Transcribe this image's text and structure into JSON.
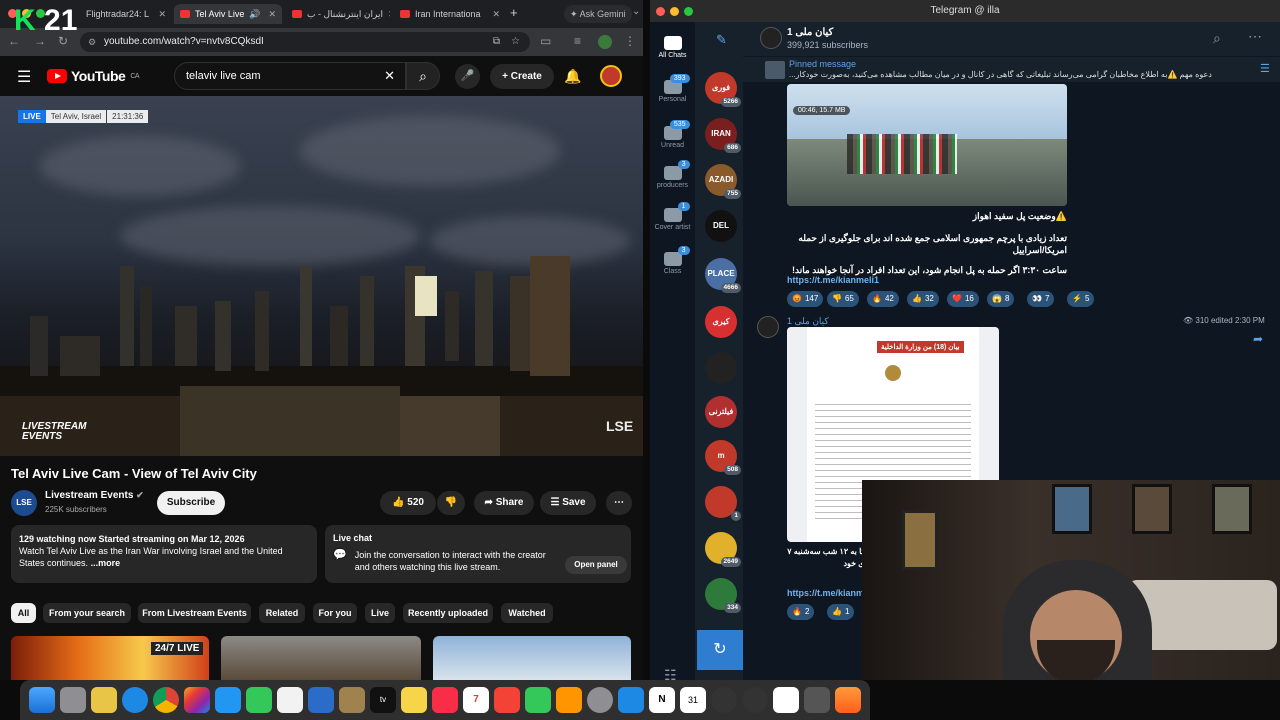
{
  "browser": {
    "tabs": [
      {
        "label": "Flightradar24: L"
      },
      {
        "label": "Tel Aviv Live"
      },
      {
        "label": "ایران اینترنشنال - ب"
      },
      {
        "label": "Iran Internationa"
      }
    ],
    "ask_gemini": "Ask Gemini",
    "url": "youtube.com/watch?v=nvtv8CQksdI",
    "k21_number": "21"
  },
  "youtube": {
    "logo": "YouTube",
    "region": "CA",
    "search_value": "telaviv live cam",
    "create_label": "Create",
    "video": {
      "live_label": "LIVE",
      "location": "Tel Aviv, Israel",
      "time": "21:31:36",
      "watermark": "LSE",
      "logo_line1": "LIVESTREAM",
      "logo_line2": "EVENTS"
    },
    "title": "Tel Aviv Live Cam - View of Tel Aviv City",
    "channel": {
      "avatar_text": "LSE",
      "name": "Livestream Events",
      "subscribers": "225K subscribers",
      "subscribe_label": "Subscribe"
    },
    "actions": {
      "likes": "520",
      "share": "Share",
      "save": "Save"
    },
    "description": {
      "stats": "129 watching now  Started streaming on Mar 12, 2026",
      "text": "Watch Tel Aviv Live as the Iran War involving Israel and the United States continues.",
      "more": "...more"
    },
    "live_chat": {
      "title": "Live chat",
      "text": "Join the conversation to interact with the creator and others watching this live stream.",
      "open_panel": "Open panel"
    },
    "chips": [
      "All",
      "From your search",
      "From Livestream Events",
      "Related",
      "For you",
      "Live",
      "Recently uploaded",
      "Watched"
    ],
    "thumb_badge": "24/7 LIVE"
  },
  "telegram": {
    "window_title": "Telegram @ illa",
    "folders": [
      {
        "label": "All Chats",
        "badge": ""
      },
      {
        "label": "Personal",
        "badge": "393"
      },
      {
        "label": "Unread",
        "badge": "535"
      },
      {
        "label": "producers",
        "badge": "3"
      },
      {
        "label": "Cover artist",
        "badge": "1"
      },
      {
        "label": "Class",
        "badge": "3"
      }
    ],
    "chat_avatars": [
      {
        "text": "فوری",
        "count": "5266",
        "color": "#c0392b"
      },
      {
        "text": "IRAN",
        "count": "686",
        "color": "#7a1f1f"
      },
      {
        "text": "AZADI",
        "count": "755",
        "color": "#8b5a2b"
      },
      {
        "text": "DEL",
        "count": "",
        "color": "#111111"
      },
      {
        "text": "PLACE",
        "count": "4666",
        "color": "#4a6fa5"
      },
      {
        "text": "کیری",
        "count": "",
        "color": "#d63031"
      },
      {
        "text": "",
        "count": "",
        "color": "#222222"
      },
      {
        "text": "فیلترنی",
        "count": "",
        "color": "#b03030"
      },
      {
        "text": "m",
        "count": "508",
        "color": "#c0392b"
      },
      {
        "text": "",
        "count": "1",
        "color": "#c0392b"
      },
      {
        "text": "",
        "count": "2649",
        "color": "#e1b12c"
      },
      {
        "text": "",
        "count": "334",
        "color": "#2d7a3a"
      }
    ],
    "channel": {
      "name": "کیان ملی 1",
      "subscribers": "399,921 subscribers"
    },
    "pinned": {
      "label": "Pinned message",
      "text": "دعوه مهم ⚠️به اطلاع مخاطبان گرامی می‌رساند تبلیغاتی که گاهی در کانال و در میان مطالب مشاهده می‌کنید، به‌صورت خودکار..."
    },
    "message1": {
      "media_duration": "00:46, 15.7 MB",
      "heading": "⚠️وضعیت پل سفید اهواز",
      "line1": "تعداد زیادی با پرچم جمهوری اسلامی جمع شده اند برای جلوگیری از حمله امریکا/اسراییل",
      "line2": "ساعت ۳:۳۰ اگر حمله به پل انجام شود، این تعداد افراد در آنجا خواهند ماند!",
      "link": "https://t.me/kianmeli1",
      "reactions": [
        {
          "emoji": "😡",
          "count": "147"
        },
        {
          "emoji": "👎",
          "count": "65"
        },
        {
          "emoji": "🔥",
          "count": "42"
        },
        {
          "emoji": "👍",
          "count": "32"
        },
        {
          "emoji": "❤️",
          "count": "16"
        },
        {
          "emoji": "😱",
          "count": "8"
        },
        {
          "emoji": "👀",
          "count": "7"
        },
        {
          "emoji": "⚡",
          "count": "5"
        }
      ]
    },
    "message2": {
      "author": "کیان ملی 1",
      "meta": "310 edited 2:30 PM",
      "doc_title": "بیان (18) من وزارة الداخلية",
      "text": "کشور خواست تا به ۱۲ شب سه‌شنبه ۷ وریل در خانه‌های خود",
      "link": "https://t.me/kianm",
      "reactions": [
        {
          "emoji": "🔥",
          "count": "2"
        },
        {
          "emoji": "👍",
          "count": "1"
        }
      ]
    }
  },
  "colors": {
    "youtube_red": "#ff0000",
    "telegram_blue": "#2f7dd1",
    "k21_green": "#14e35a"
  }
}
